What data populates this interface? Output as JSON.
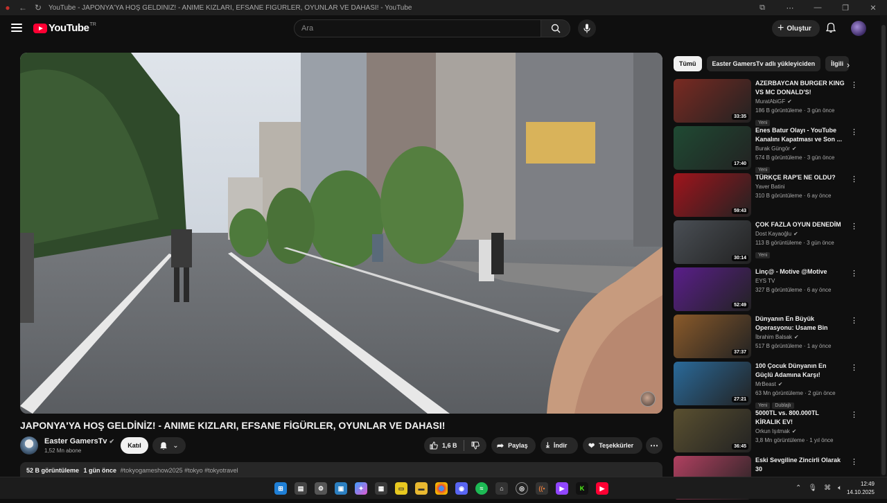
{
  "window": {
    "title": "YouTube - JAPONYA'YA HOŞ GELDİNİZ! - ANIME KIZLARI, EFSANE FİGÜRLER, OYUNLAR VE DAHASI! - YouTube"
  },
  "masthead": {
    "logo_text": "YouTube",
    "logo_country": "TR",
    "search_placeholder": "Ara",
    "create_label": "Oluştur"
  },
  "video": {
    "title": "JAPONYA'YA HOŞ GELDİNİZ! - ANIME KIZLARI, EFSANE FİGÜRLER, OYUNLAR VE DAHASI!",
    "channel_name": "Easter GamersTv",
    "subscribers": "1,52 Mn abone",
    "join_label": "Katıl",
    "like_count": "1,6 B",
    "share_label": "Paylaş",
    "download_label": "İndir",
    "thanks_label": "Teşekkürler",
    "more_label": "⋯",
    "views": "52 B görüntüleme",
    "published": "1 gün önce",
    "tags": "#tokyogameshow2025 #tokyo #tokyotravel"
  },
  "chips": [
    {
      "label": "Tümü",
      "active": true
    },
    {
      "label": "Easter GamersTv adlı yükleyiciden",
      "active": false
    },
    {
      "label": "İlgili",
      "active": false
    }
  ],
  "recommendations": [
    {
      "title": "AZERBAYCAN BURGER KING VS MC DONALD'S!",
      "channel": "MuratAbiGF",
      "verified": true,
      "views": "186 B görüntüleme · 3 gün önce",
      "duration": "33:35",
      "badges": [
        "Yeni"
      ],
      "color": "#7a2a22"
    },
    {
      "title": "Enes Batur Olayı - YouTube Kanalını Kapatması ve Son ...",
      "channel": "Burak Güngör",
      "verified": true,
      "views": "574 B görüntüleme · 3 gün önce",
      "duration": "17:40",
      "badges": [
        "Yeni"
      ],
      "color": "#1f4a33"
    },
    {
      "title": "TÜRKÇE RAP'E NE OLDU?",
      "channel": "Yaver Batini",
      "verified": false,
      "views": "310 B görüntüleme · 6 ay önce",
      "duration": "59:43",
      "badges": [],
      "color": "#a0141c"
    },
    {
      "title": "ÇOK FAZLA OYUN DENEDİM",
      "channel": "Dost Kayaoğlu",
      "verified": true,
      "views": "113 B görüntüleme · 3 gün önce",
      "duration": "30:14",
      "badges": [
        "Yeni"
      ],
      "color": "#4a4f55"
    },
    {
      "title": "Linç@ - Motive @Motive",
      "channel": "EYS TV",
      "verified": false,
      "views": "327 B görüntüleme · 6 ay önce",
      "duration": "52:49",
      "badges": [],
      "color": "#5a1e8a"
    },
    {
      "title": "Dünyanın En Büyük Operasyonu: Usame Bin Ladin Gerçekten ...",
      "channel": "İbrahim Balsak",
      "verified": true,
      "views": "517 B görüntüleme · 1 ay önce",
      "duration": "37:37",
      "badges": [],
      "color": "#8a5a2a"
    },
    {
      "title": "100 Çocuk Dünyanın En Güçlü Adamına Karşı!",
      "channel": "MrBeast",
      "verified": true,
      "views": "63 Mn görüntüleme · 2 gün önce",
      "duration": "27:21",
      "badges": [
        "Yeni",
        "Dublajlı"
      ],
      "color": "#2a6a9a"
    },
    {
      "title": "5000TL vs. 800.000TL KİRALIK EV! (#SonradanGörme)",
      "channel": "Orkun Işıtmak",
      "verified": true,
      "views": "3,8 Mn görüntüleme · 1 yıl önce",
      "duration": "36:45",
      "badges": [],
      "color": "#5a5030"
    },
    {
      "title": "Eski Sevgiline Zincirli Olarak 30",
      "channel": "",
      "verified": false,
      "views": "",
      "duration": "",
      "badges": [],
      "color": "#b04060"
    }
  ],
  "taskbar": {
    "time": "12:49",
    "date": "14.10.2025"
  }
}
